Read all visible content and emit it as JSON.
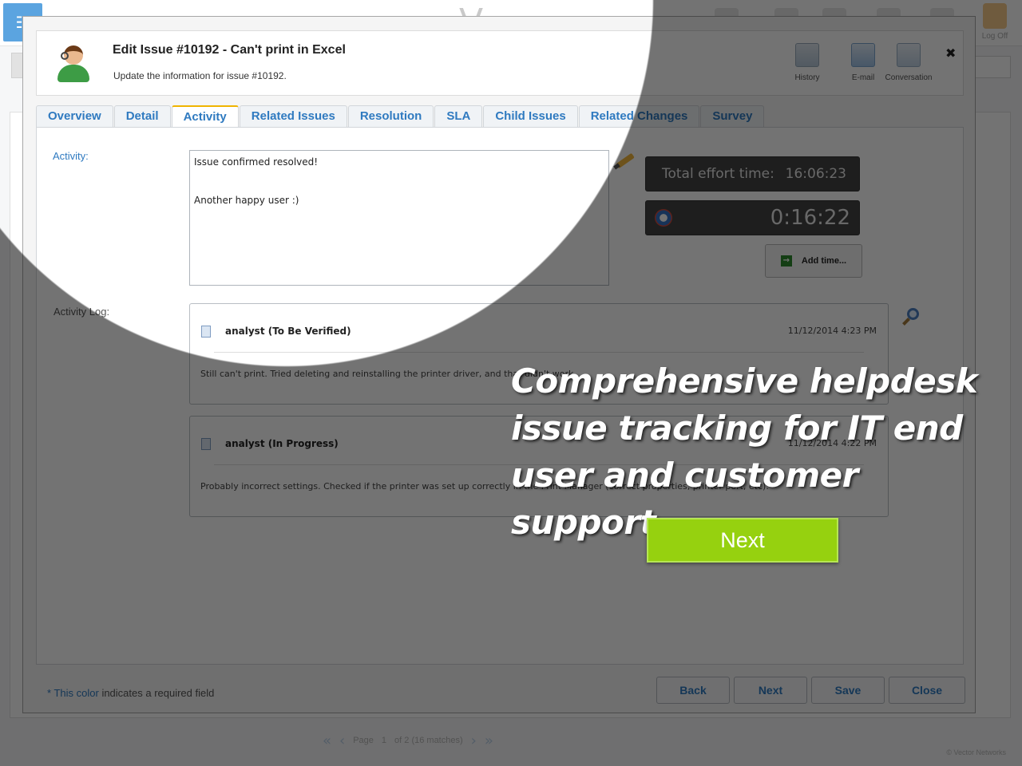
{
  "background": {
    "logo_text": "V",
    "log_off_label": "Log Off",
    "pager": {
      "page_text": "Page",
      "page_current": "1",
      "page_rest": "of 2 (16 matches)"
    },
    "copyright": "© Vector Networks"
  },
  "modal": {
    "title": "Edit Issue #10192 - Can't print in Excel",
    "subtitle": "Update the information for issue #10192.",
    "header_actions": {
      "history": "History",
      "email": "E-mail",
      "conversation": "Conversation"
    },
    "close_glyph": "✖"
  },
  "tabs": [
    {
      "label": "Overview"
    },
    {
      "label": "Detail"
    },
    {
      "label": "Activity",
      "active": true
    },
    {
      "label": "Related Issues"
    },
    {
      "label": "Resolution"
    },
    {
      "label": "SLA"
    },
    {
      "label": "Child Issues"
    },
    {
      "label": "Related Changes"
    },
    {
      "label": "Survey"
    }
  ],
  "activity": {
    "label": "Activity:",
    "text_line1": "Issue confirmed resolved!",
    "text_line2": "Another happy user :)",
    "total_effort_label": "Total effort time:",
    "total_effort_value": "16:06:23",
    "timer_value": "0:16:22",
    "add_time_label": "Add time..."
  },
  "activity_log": {
    "label": "Activity Log:",
    "entries": [
      {
        "author": "analyst (To Be Verified)",
        "date": "11/12/2014 4:23 PM",
        "body": "Still can't print. Tried deleting and reinstalling the printer driver, and that didn't work."
      },
      {
        "author": "analyst (In Progress)",
        "date": "11/12/2014 4:22 PM",
        "body": "Probably incorrect settings. Checked if the printer was set up correctly in the Print Manager (correct properties, printer port, etc)."
      }
    ]
  },
  "footer": {
    "required_star": "*",
    "required_accent": "This color",
    "required_rest": "indicates a required field",
    "buttons": {
      "back": "Back",
      "next": "Next",
      "save": "Save",
      "close": "Close"
    }
  },
  "tour": {
    "text": "Comprehensive helpdesk issue tracking for IT end user and customer support.",
    "next_label": "Next"
  },
  "colors": {
    "accent_blue": "#2f7ac0",
    "active_tab_border": "#f0b400",
    "tour_next_green": "#96d10f",
    "timer_background": "#444444"
  }
}
